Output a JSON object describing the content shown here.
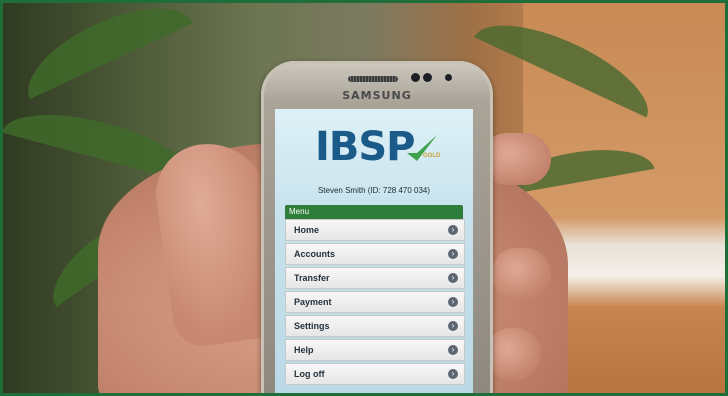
{
  "phone": {
    "brand": "SAMSUNG"
  },
  "app": {
    "logo_text": "IBSP",
    "logo_badge": "GOLD",
    "user_line": "Steven Smith (ID: 728 470 034)",
    "menu_title": "Menu",
    "menu_items": [
      {
        "label": "Home",
        "icon": "chevron-right-icon"
      },
      {
        "label": "Accounts",
        "icon": "chevron-right-icon"
      },
      {
        "label": "Transfer",
        "icon": "chevron-right-icon"
      },
      {
        "label": "Payment",
        "icon": "chevron-right-icon"
      },
      {
        "label": "Settings",
        "icon": "chevron-right-icon"
      },
      {
        "label": "Help",
        "icon": "chevron-right-icon"
      },
      {
        "label": "Log off",
        "icon": "chevron-right-icon"
      }
    ]
  },
  "colors": {
    "frame_border": "#1f6e3a",
    "logo_blue": "#1b5b8a",
    "menu_header_green": "#2e7d3a"
  }
}
